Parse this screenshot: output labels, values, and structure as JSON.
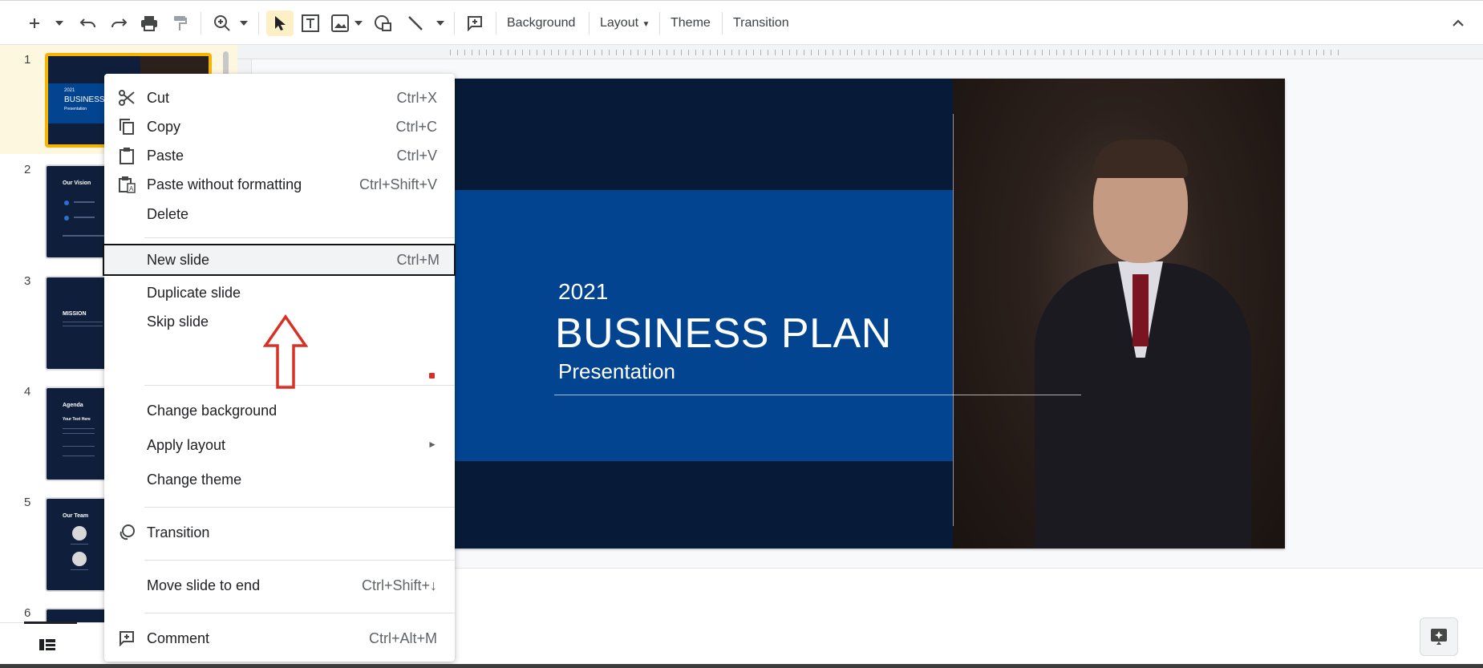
{
  "toolbar": {
    "background_label": "Background",
    "layout_label": "Layout",
    "theme_label": "Theme",
    "transition_label": "Transition"
  },
  "filmstrip": {
    "slides": [
      {
        "number": "1",
        "title": "BUSINESS",
        "subtitle": "Presentation",
        "year": "2021"
      },
      {
        "number": "2",
        "title": "Our Vision"
      },
      {
        "number": "3",
        "title": "MISSION"
      },
      {
        "number": "4",
        "title": "Agenda",
        "subtitle": "Your Text Here"
      },
      {
        "number": "5",
        "title": "Our Team"
      },
      {
        "number": "6",
        "title": ""
      }
    ]
  },
  "slide": {
    "year": "2021",
    "title": "BUSINESS PLAN",
    "subtitle": "Presentation"
  },
  "context_menu": {
    "items": [
      {
        "label": "Cut",
        "shortcut": "Ctrl+X",
        "icon": "scissors-icon"
      },
      {
        "label": "Copy",
        "shortcut": "Ctrl+C",
        "icon": "copy-icon"
      },
      {
        "label": "Paste",
        "shortcut": "Ctrl+V",
        "icon": "clipboard-icon"
      },
      {
        "label": "Paste without formatting",
        "shortcut": "Ctrl+Shift+V",
        "icon": "paste-plain-icon"
      },
      {
        "label": "Delete",
        "shortcut": ""
      },
      {
        "label": "New slide",
        "shortcut": "Ctrl+M"
      },
      {
        "label": "Duplicate slide",
        "shortcut": ""
      },
      {
        "label": "Skip slide",
        "shortcut": ""
      },
      {
        "label": "Change background",
        "shortcut": ""
      },
      {
        "label": "Apply layout",
        "shortcut": ""
      },
      {
        "label": "Change theme",
        "shortcut": ""
      },
      {
        "label": "Transition",
        "shortcut": "",
        "icon": "transition-icon"
      },
      {
        "label": "Move slide to end",
        "shortcut": "Ctrl+Shift+↓"
      },
      {
        "label": "Comment",
        "shortcut": "Ctrl+Alt+M",
        "icon": "comment-icon"
      }
    ],
    "submenu_arrow": "►"
  },
  "colors": {
    "slide_background": "#071b38",
    "slide_band": "#034491",
    "selected_border": "#f4b400",
    "annotation_red": "#d93025"
  }
}
